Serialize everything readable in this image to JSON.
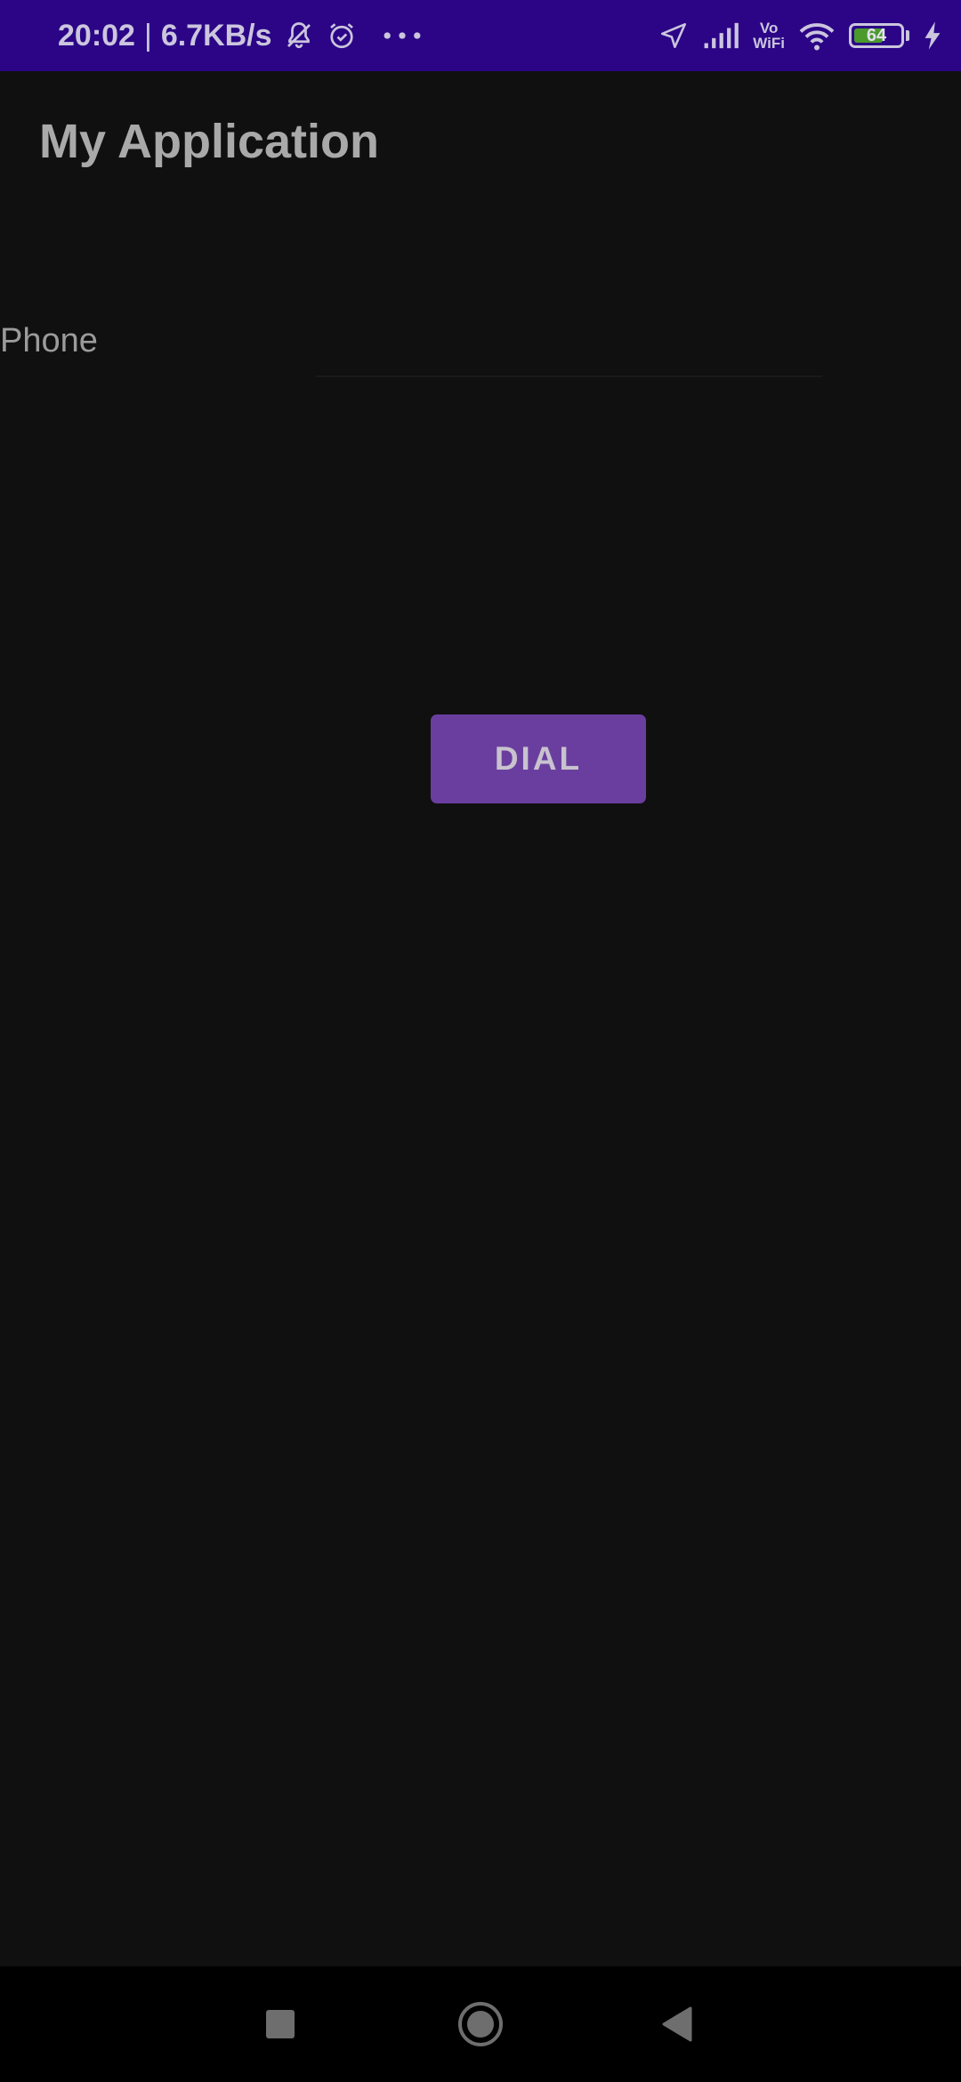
{
  "status_bar": {
    "time": "20:02",
    "separator": "|",
    "network_speed": "6.7KB/s",
    "vowifi_top": "Vo",
    "vowifi_bottom": "WiFi",
    "battery_level": "64",
    "battery_fraction": 0.64,
    "background_color": "#2b0586",
    "icons_left": [
      "bell-off-icon",
      "alarm-icon",
      "more-dots-icon"
    ],
    "icons_right": [
      "location-arrow-icon",
      "signal-icon",
      "vowifi-icon",
      "wifi-icon",
      "battery-icon",
      "charging-bolt-icon"
    ]
  },
  "app_bar": {
    "title": "My Application"
  },
  "form": {
    "phone_label": "Phone",
    "phone_value": "",
    "dial_label": "DIAL",
    "dial_color": "#6a3e9e"
  },
  "nav_bar": {
    "items": [
      "recents-square-icon",
      "home-circle-icon",
      "back-triangle-icon"
    ]
  }
}
